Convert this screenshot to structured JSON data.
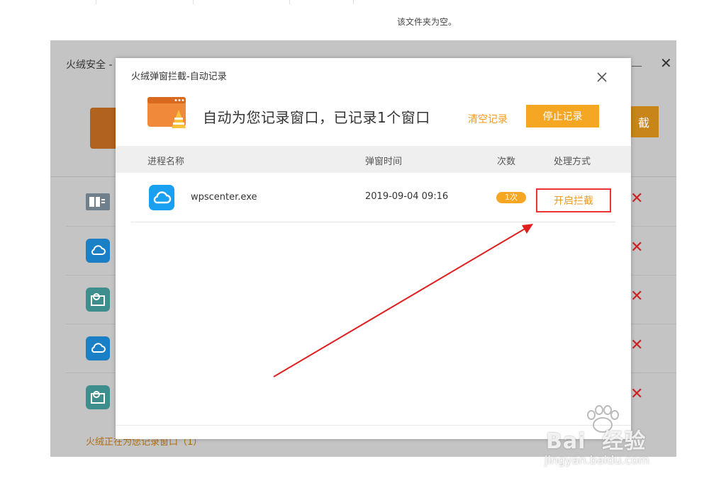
{
  "folder_status": "该文件夹为空。",
  "background_window": {
    "title": "火绒安全 -",
    "stop_button_char": "截",
    "footer_text": "火绒正在为您记录窗口（1）",
    "row_icons": [
      "columns-icon",
      "cloud-icon",
      "disk-icon",
      "cloud-icon",
      "disk-icon"
    ],
    "row_remove_symbol": "✕"
  },
  "dialog": {
    "title": "火绒弹窗拦截-自动记录",
    "banner_text": "自动为您记录窗口，已记录1个窗口",
    "clear_label": "清空记录",
    "stop_label": "停止记录",
    "columns": {
      "process": "进程名称",
      "time": "弹窗时间",
      "count": "次数",
      "action": "处理方式"
    },
    "rows": [
      {
        "name": "wpscenter.exe",
        "time": "2019-09-04 09:16",
        "count": "1次",
        "action": "开启拦截",
        "icon": "cloud-icon"
      }
    ]
  },
  "watermark": {
    "brand": "Bai  经验",
    "url": "jingyan.baidu.com"
  },
  "colors": {
    "accent": "#f5a623",
    "highlight_border": "#e33333",
    "arrow": "#e02020"
  }
}
